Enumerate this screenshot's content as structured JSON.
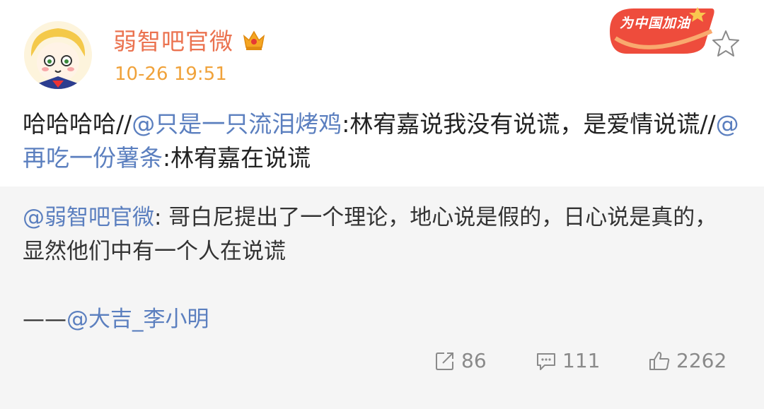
{
  "user": {
    "name": "弱智吧官微",
    "timestamp": "10-26 19:51",
    "badge_text": "为中国加油"
  },
  "post": {
    "part1": "哈哈哈哈//",
    "mention1": "@只是一只流泪烤鸡",
    "part2": ":林宥嘉说我没有说谎，是爱情说谎//",
    "mention2": "@再吃一份薯条",
    "part3": ":林宥嘉在说谎"
  },
  "repost": {
    "mention": "@弱智吧官微",
    "text": ": 哥白尼提出了一个理论，地心说是假的，日心说是真的，显然他们中有一个人在说谎",
    "credit_prefix": "——",
    "credit_mention": "@大吉_李小明"
  },
  "actions": {
    "repost_count": "86",
    "comment_count": "111",
    "like_count": "2262"
  },
  "colors": {
    "name": "#eb7350",
    "time": "#f0a23a",
    "link": "#5b7fbf",
    "repost_bg": "#f5f5f5"
  },
  "icons": [
    "crown-icon",
    "star-icon",
    "repost-icon",
    "comment-icon",
    "like-icon"
  ]
}
